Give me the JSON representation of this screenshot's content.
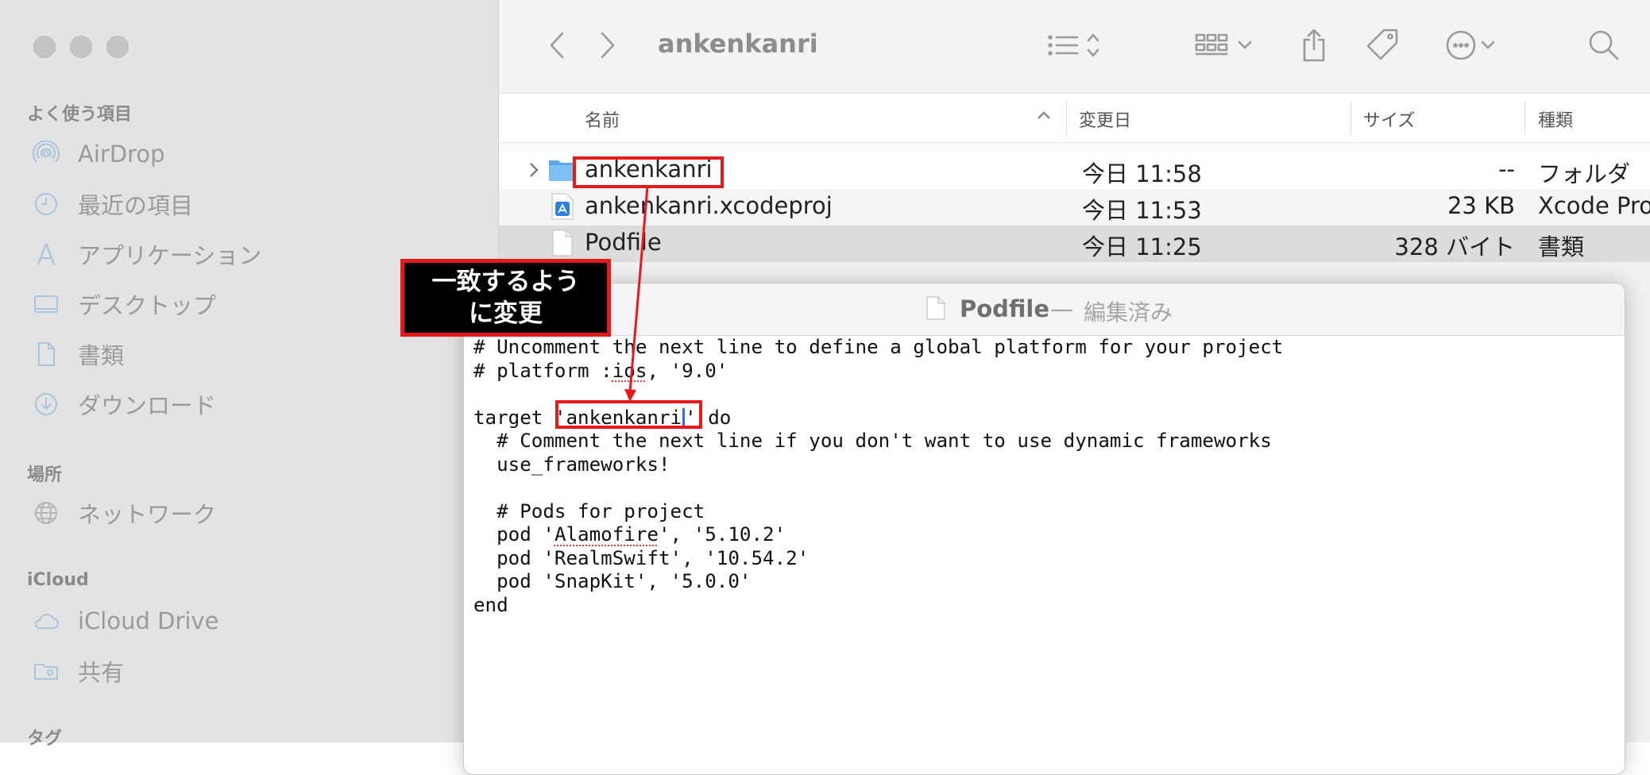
{
  "sidebar": {
    "sections": [
      {
        "title": "よく使う項目"
      },
      {
        "title": "場所"
      },
      {
        "title": "iCloud"
      },
      {
        "title": "タグ"
      }
    ],
    "items": [
      {
        "label": "AirDrop",
        "icon": "airdrop-icon"
      },
      {
        "label": "最近の項目",
        "icon": "clock-icon"
      },
      {
        "label": "アプリケーション",
        "icon": "applications-icon"
      },
      {
        "label": "デスクトップ",
        "icon": "desktop-icon"
      },
      {
        "label": "書類",
        "icon": "document-icon"
      },
      {
        "label": "ダウンロード",
        "icon": "download-icon"
      },
      {
        "label": "ネットワーク",
        "icon": "network-icon"
      },
      {
        "label": "iCloud Drive",
        "icon": "cloud-icon"
      },
      {
        "label": "共有",
        "icon": "shared-folder-icon"
      }
    ]
  },
  "toolbar": {
    "title": "ankenkanri"
  },
  "columns": {
    "name": "名前",
    "date": "変更日",
    "size": "サイズ",
    "kind": "種類"
  },
  "files": [
    {
      "name": "ankenkanri",
      "date": "今日 11:58",
      "size": "--",
      "kind": "フォルダ",
      "icon": "folder-icon"
    },
    {
      "name": "ankenkanri.xcodeproj",
      "date": "今日 11:53",
      "size": "23 KB",
      "kind": "Xcode Pro",
      "icon": "xcodeproj-icon"
    },
    {
      "name": "Podfile",
      "date": "今日 11:25",
      "size": "328 バイト",
      "kind": "書類",
      "icon": "document-icon"
    }
  ],
  "textedit": {
    "filename": "Podfile",
    "separator": "—",
    "state": "編集済み",
    "lines": {
      "l1": "# Uncomment the next line to define a global platform for your project",
      "l2a": "# platform :",
      "l2b": "ios",
      "l2c": ", '9.0'",
      "l3": "",
      "l4a": "target ",
      "l4b": "'ankenkanri",
      "l4c": "'",
      "l4d": " do",
      "l5": "  # Comment the next line if you don't want to use dynamic frameworks",
      "l6": "  use_frameworks!",
      "l7": "",
      "l8": "  # Pods for project",
      "l9a": "  pod '",
      "l9b": "Alamofire",
      "l9c": "', '5.10.2'",
      "l10": "  pod 'RealmSwift', '10.54.2'",
      "l11": "  pod 'SnapKit', '5.0.0'",
      "l12": "end"
    }
  },
  "annotation": {
    "line1": "一致するよう",
    "line2": "に変更",
    "color": "#e8191b"
  }
}
